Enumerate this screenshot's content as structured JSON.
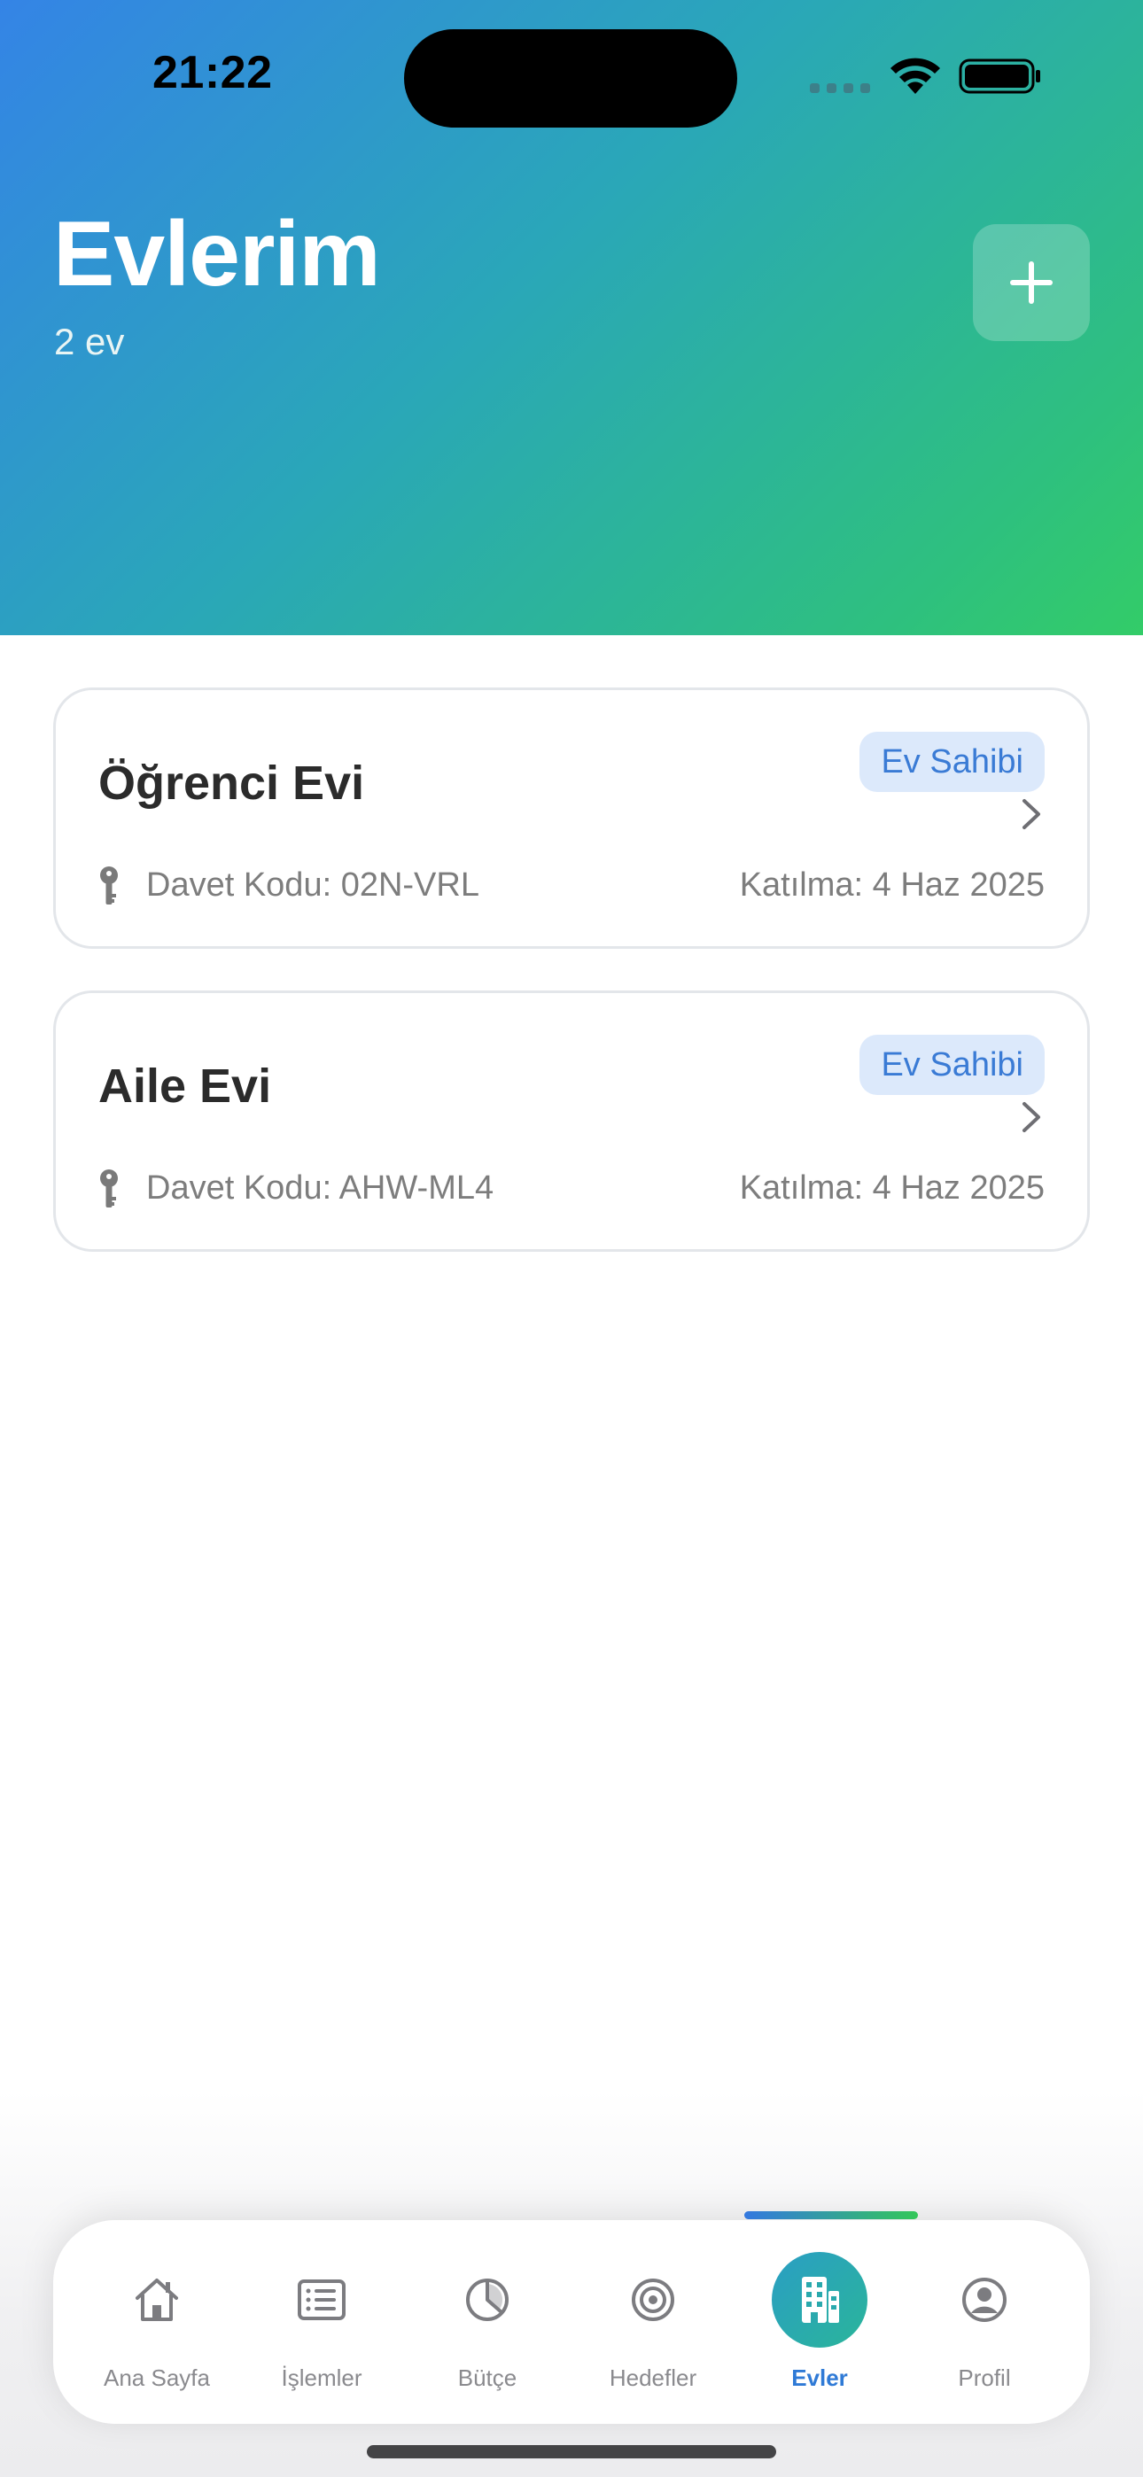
{
  "status_bar": {
    "time": "21:22"
  },
  "header": {
    "title": "Evlerim",
    "subtitle": "2 ev",
    "add_icon": "plus-icon"
  },
  "houses": [
    {
      "name": "Öğrenci Evi",
      "role": "Ev Sahibi",
      "invite_code": "Davet Kodu: 02N-VRL",
      "joined": "Katılma: 4 Haz 2025"
    },
    {
      "name": "Aile Evi",
      "role": "Ev Sahibi",
      "invite_code": "Davet Kodu: AHW-ML4",
      "joined": "Katılma: 4 Haz 2025"
    }
  ],
  "tab_bar": {
    "active": "Evler",
    "tabs": [
      {
        "label": "Ana Sayfa",
        "icon": "house-icon"
      },
      {
        "label": "İşlemler",
        "icon": "list-icon"
      },
      {
        "label": "Bütçe",
        "icon": "pie-chart-icon"
      },
      {
        "label": "Hedefler",
        "icon": "target-icon"
      },
      {
        "label": "Evler",
        "icon": "building-icon"
      },
      {
        "label": "Profil",
        "icon": "profile-icon"
      }
    ]
  },
  "colors": {
    "header_gradient_start": "#3484e6",
    "header_gradient_end": "#33cc68",
    "badge_bg": "#dce9fb",
    "badge_text": "#3a7bd5",
    "active_tab": "#2f7ad6"
  }
}
